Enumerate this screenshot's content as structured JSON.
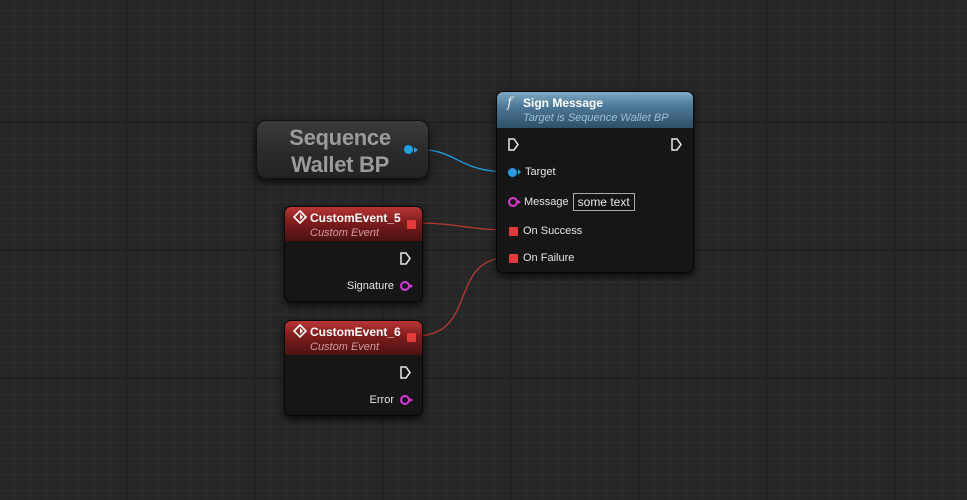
{
  "colors": {
    "object_pin": "#1ea0e6",
    "string_pin": "#d63bd6",
    "delegate_pin": "#e23b3b",
    "exec_pin": "#e8e8e8",
    "function_header": "#4d7898",
    "event_header": "#7e1c1c"
  },
  "variable_node": {
    "line1": "Sequence",
    "line2": "Wallet BP",
    "output_pin_icon": "object-pin-icon"
  },
  "sign_message": {
    "icon": "f",
    "title": "Sign Message",
    "subtitle": "Target is Sequence Wallet BP",
    "pins": {
      "target_label": "Target",
      "message_label": "Message",
      "message_value": "some text",
      "on_success_label": "On Success",
      "on_failure_label": "On Failure"
    }
  },
  "custom_event_5": {
    "title": "CustomEvent_5",
    "subtitle": "Custom Event",
    "output_label": "Signature"
  },
  "custom_event_6": {
    "title": "CustomEvent_6",
    "subtitle": "Custom Event",
    "output_label": "Error"
  }
}
